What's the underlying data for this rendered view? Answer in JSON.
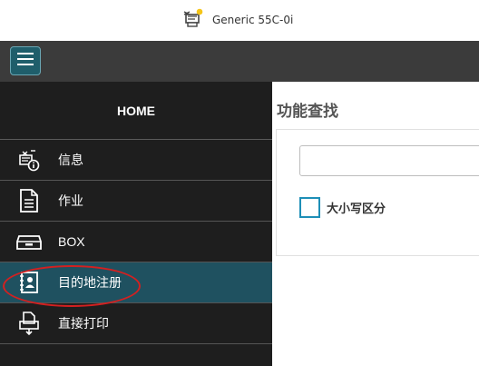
{
  "header": {
    "device_icon": "printer-icon",
    "device_name": "Generic 55C-0i"
  },
  "toolbar": {
    "menu_icon": "hamburger-menu-icon"
  },
  "sidebar": {
    "home_label": "HOME",
    "items": [
      {
        "label": "信息",
        "icon": "printer-info-icon"
      },
      {
        "label": "作业",
        "icon": "document-icon"
      },
      {
        "label": "BOX",
        "icon": "box-tray-icon"
      },
      {
        "label": "目的地注册",
        "icon": "address-book-icon",
        "active": true
      },
      {
        "label": "直接打印",
        "icon": "direct-print-icon"
      }
    ]
  },
  "main": {
    "title": "功能查找",
    "search": {
      "value": "",
      "placeholder": ""
    },
    "case_sensitive_label": "大小写区分"
  },
  "colors": {
    "toolbar_bg": "#3b3b3b",
    "sidebar_bg": "#1e1e1e",
    "active_item_bg": "#1f5160",
    "accent": "#1e8fb7",
    "annotation_red": "#d42020"
  }
}
